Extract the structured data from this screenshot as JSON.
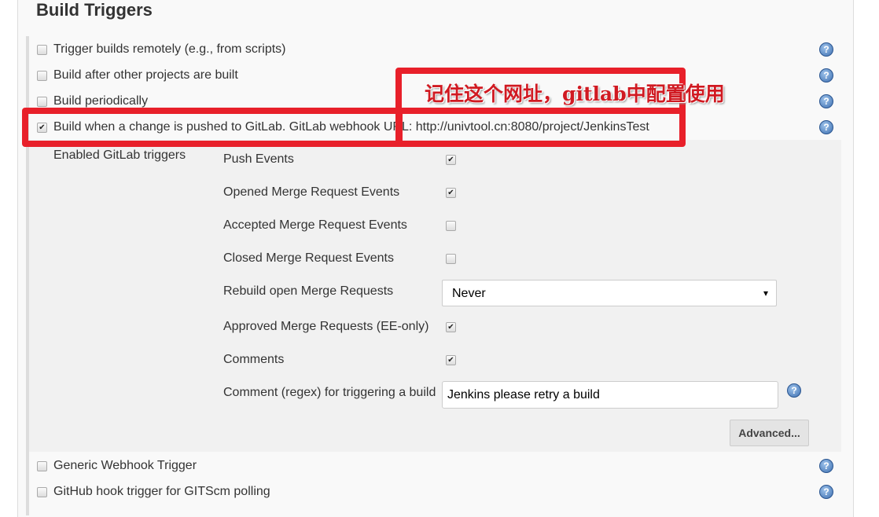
{
  "section_title": "Build Triggers",
  "triggers": [
    {
      "label": "Trigger builds remotely (e.g., from scripts)",
      "checked": false
    },
    {
      "label": "Build after other projects are built",
      "checked": false
    },
    {
      "label": "Build periodically",
      "checked": false
    },
    {
      "label": "Build when a change is pushed to GitLab. GitLab webhook URL: http://univtool.cn:8080/project/JenkinsTest",
      "checked": true
    },
    {
      "label": "Generic Webhook Trigger",
      "checked": false
    },
    {
      "label": "GitHub hook trigger for GITScm polling",
      "checked": false
    }
  ],
  "gitlab": {
    "enabled_label": "Enabled GitLab triggers",
    "options": [
      {
        "label": "Push Events",
        "checked": true
      },
      {
        "label": "Opened Merge Request Events",
        "checked": true
      },
      {
        "label": "Accepted Merge Request Events",
        "checked": false
      },
      {
        "label": "Closed Merge Request Events",
        "checked": false
      }
    ],
    "rebuild_label": "Rebuild open Merge Requests",
    "rebuild_value": "Never",
    "approved_label": "Approved Merge Requests (EE-only)",
    "approved_checked": true,
    "comments_label": "Comments",
    "comments_checked": true,
    "comment_regex_label": "Comment (regex) for triggering a build",
    "comment_regex_value": "Jenkins please retry a build",
    "advanced_label": "Advanced..."
  },
  "annotation": {
    "text": "记住这个网址，gitlab中配置使用",
    "color": "#e8202a"
  },
  "icons": {
    "help": "help-icon",
    "check": "✔",
    "dropdown": "▾",
    "help_glyph": "?"
  }
}
